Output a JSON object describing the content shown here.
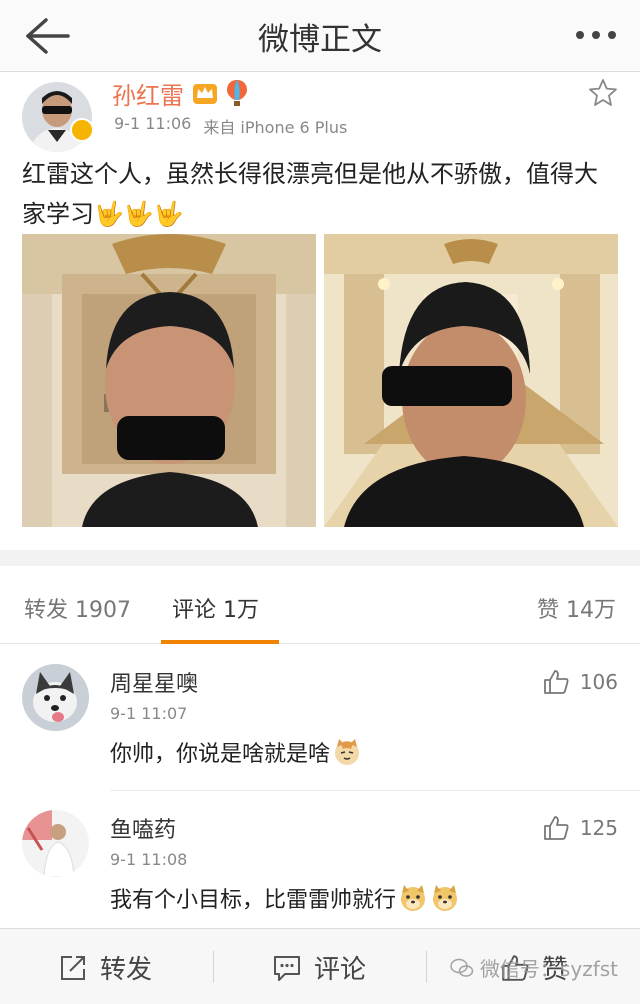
{
  "nav": {
    "title": "微博正文",
    "back_icon": "arrow-left-icon",
    "more_icon": "ellipsis-icon"
  },
  "post": {
    "author": "孙红雷",
    "time": "9-1 11:06",
    "source": "来自 iPhone 6 Plus",
    "text": "红雷这个人，虽然长得很漂亮但是他从不骄傲，值得大家学习🤟🤟🤟",
    "accent_color": "#eb7350"
  },
  "tabs": {
    "repost": "转发 1907",
    "comment": "评论 1万",
    "like": "赞 14万",
    "active_color": "#f08300"
  },
  "comments": [
    {
      "name": "周星星噢",
      "time": "9-1 11:07",
      "text": "你帅，你说是啥就是啥",
      "likes": "106"
    },
    {
      "name": "鱼嗑药",
      "time": "9-1 11:08",
      "text": "我有个小目标，比雷雷帅就行",
      "likes": "125"
    }
  ],
  "bottom": {
    "repost": "转发",
    "comment": "评论",
    "like": "赞",
    "watermark": "微信号：syzfst"
  }
}
